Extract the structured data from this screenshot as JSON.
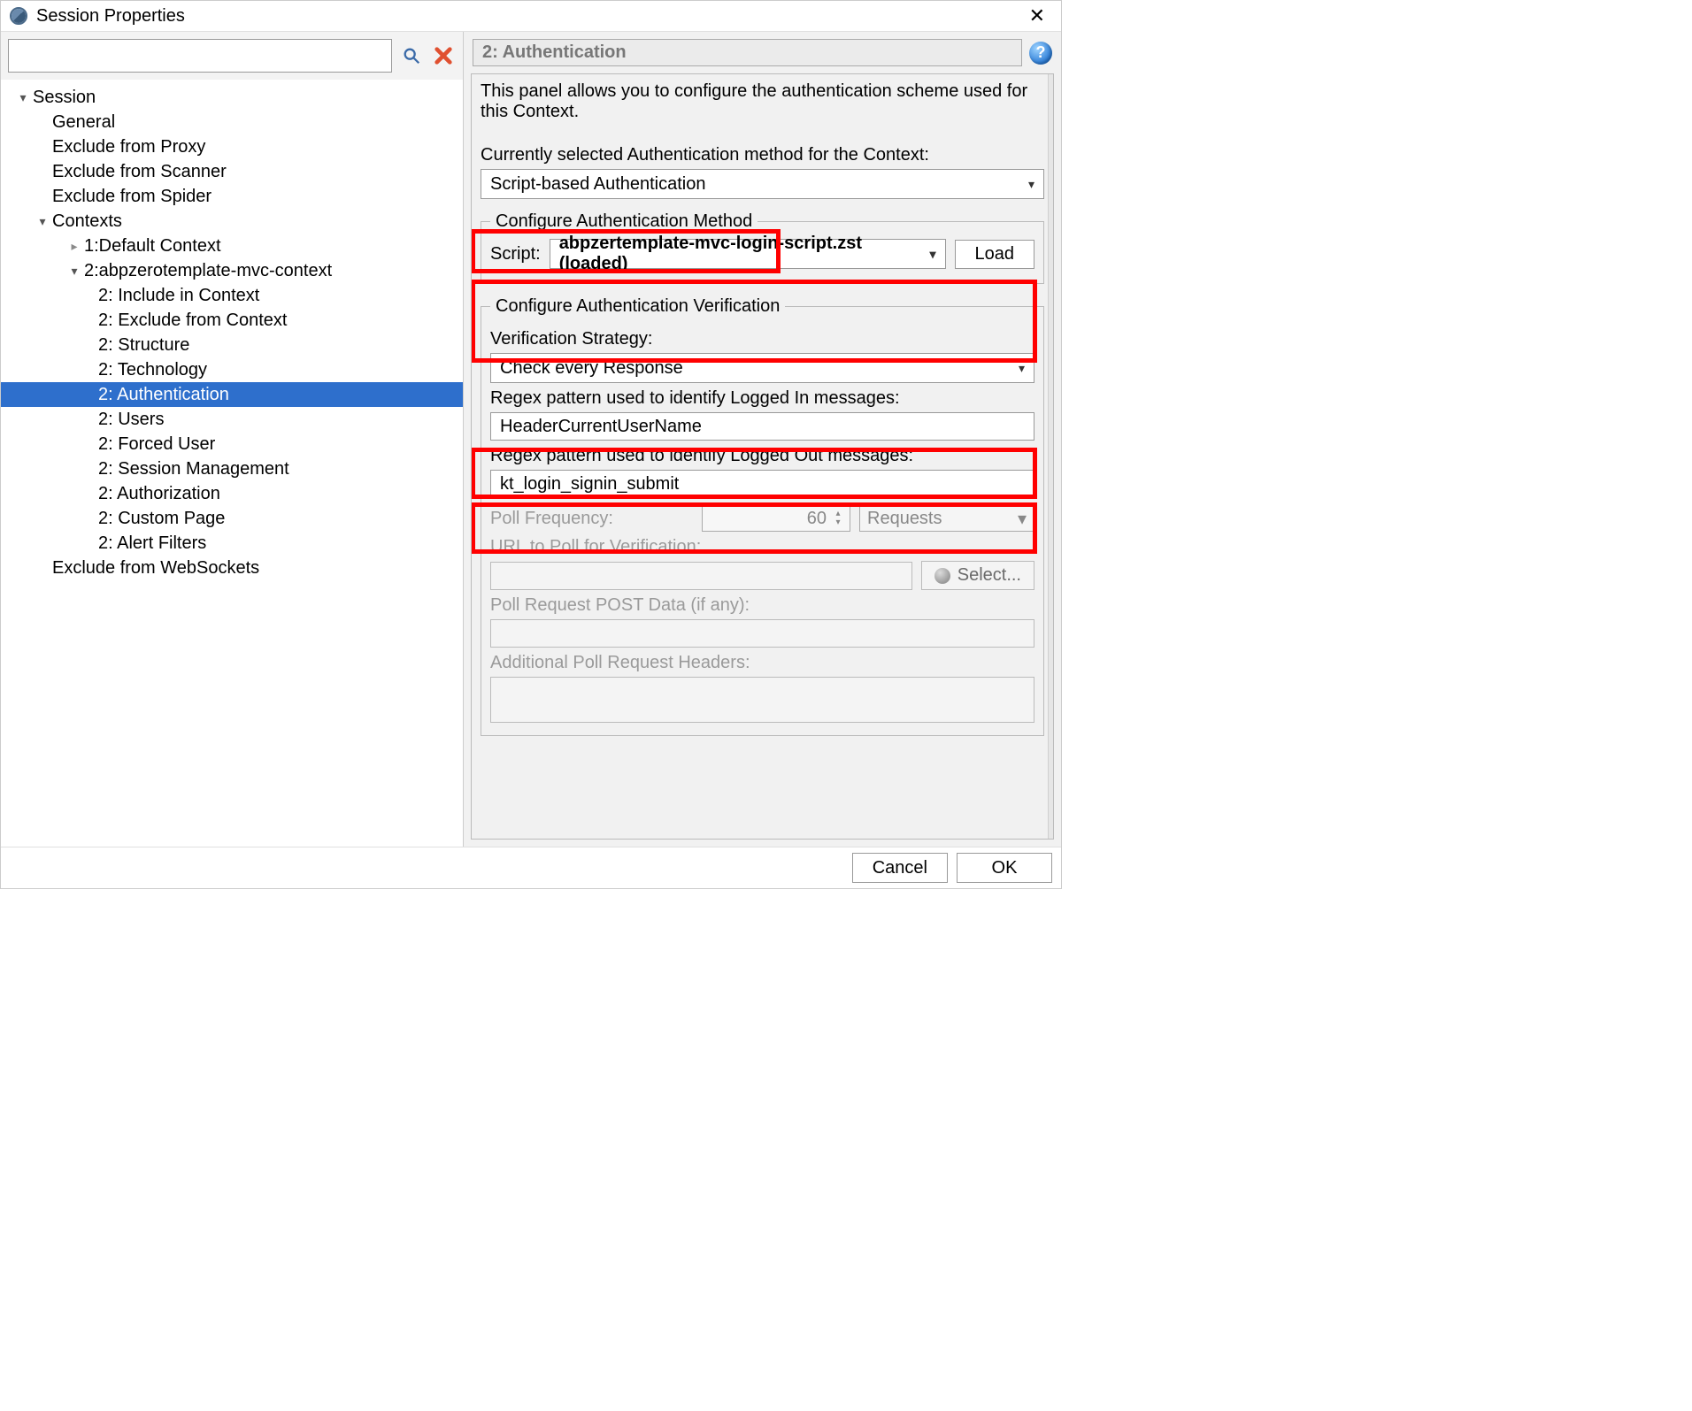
{
  "window": {
    "title": "Session Properties"
  },
  "left": {
    "search": {
      "value": ""
    },
    "tree": {
      "session": "Session",
      "general": "General",
      "excludeFromProxy": "Exclude from Proxy",
      "excludeFromScanner": "Exclude from Scanner",
      "excludeFromSpider": "Exclude from Spider",
      "contexts": "Contexts",
      "defaultContext": "1:Default Context",
      "context2": "2:abpzerotemplate-mvc-context",
      "c2_include": "2: Include in Context",
      "c2_exclude": "2: Exclude from Context",
      "c2_structure": "2: Structure",
      "c2_technology": "2: Technology",
      "c2_auth": "2: Authentication",
      "c2_users": "2: Users",
      "c2_forcedUser": "2: Forced User",
      "c2_sessionMgmt": "2: Session Management",
      "c2_authorization": "2: Authorization",
      "c2_customPage": "2: Custom Page",
      "c2_alertFilters": "2: Alert Filters",
      "excludeFromWebsockets": "Exclude from WebSockets"
    }
  },
  "right": {
    "breadcrumb": "2: Authentication",
    "description": "This panel allows you to configure the authentication scheme used for this Context.",
    "currentLabel": "Currently selected Authentication method for the Context:",
    "authMethod": "Script-based Authentication",
    "configureMethodLegend": "Configure Authentication Method",
    "scriptLabel": "Script:",
    "scriptValue": "abpzertemplate-mvc-login-script.zst (loaded)",
    "loadBtn": "Load",
    "verifyLegend": "Configure Authentication Verification",
    "verifyStrategyLabel": "Verification Strategy:",
    "verifyStrategy": "Check every Response",
    "loggedInLabel": "Regex pattern used to identify Logged In messages:",
    "loggedInValue": "HeaderCurrentUserName",
    "loggedOutLabel": "Regex pattern used to identify Logged Out messages:",
    "loggedOutValue": "kt_login_signin_submit",
    "pollFreqLabel": "Poll Frequency:",
    "pollFreqValue": "60",
    "pollUnit": "Requests",
    "urlToPollLabel": "URL to Poll for Verification:",
    "selectBtn": "Select...",
    "postDataLabel": "Poll Request POST Data (if any):",
    "addHeadersLabel": "Additional Poll Request Headers:"
  },
  "footer": {
    "cancel": "Cancel",
    "ok": "OK"
  }
}
